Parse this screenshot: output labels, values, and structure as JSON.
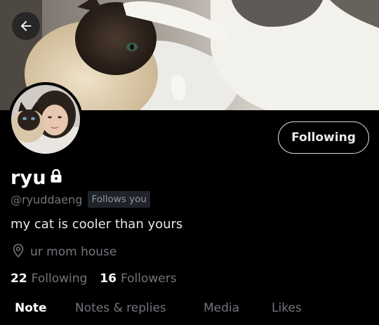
{
  "profile": {
    "name": "ryu",
    "handle": "@ryuddaeng",
    "follows_you_badge": "Follows you",
    "bio": "my cat is cooler than yours",
    "location": "ur mom house",
    "following_count": "22",
    "following_label": "Following",
    "followers_count": "16",
    "followers_label": "Followers"
  },
  "actions": {
    "follow_button_label": "Following"
  },
  "tabs": [
    {
      "label": "Note",
      "active": true
    },
    {
      "label": "Notes & replies",
      "active": false
    },
    {
      "label": "Media",
      "active": false
    },
    {
      "label": "Likes",
      "active": false
    }
  ],
  "icons": {
    "back": "arrow-left-icon",
    "lock": "lock-icon",
    "location": "location-pin-icon"
  },
  "colors": {
    "background": "#000000",
    "primary_text": "#e7e9ea",
    "secondary_text": "#71767b",
    "badge_bg": "#202327"
  }
}
